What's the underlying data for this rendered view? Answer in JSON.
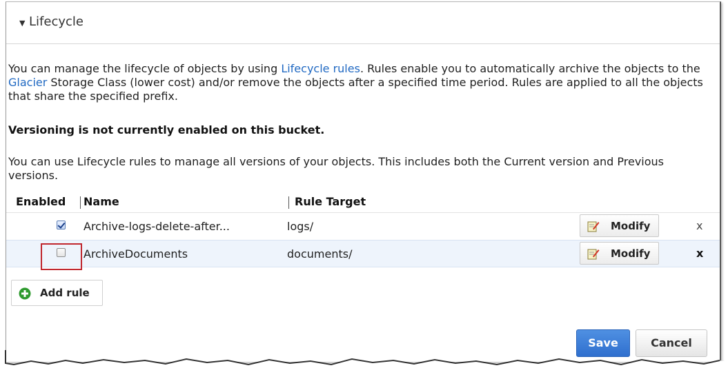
{
  "section": {
    "title": "Lifecycle",
    "caret_icon": "triangle-down-icon"
  },
  "intro": {
    "part1": "You can manage the lifecycle of objects by using ",
    "link_lifecycle": "Lifecycle rules",
    "part2": ". Rules enable you to automatically archive the objects to the ",
    "link_glacier": "Glacier",
    "part3": " Storage Class (lower cost) and/or remove the objects after a specified time period. Rules are applied to all the objects that share the specified prefix."
  },
  "warning": "Versioning is not currently enabled on this bucket.",
  "versions_text": "You can use Lifecycle rules to manage all versions of your objects. This includes both the Current version and Previous versions.",
  "table": {
    "headers": {
      "enabled": "Enabled",
      "name": "Name",
      "target": "Rule Target"
    },
    "rows": [
      {
        "enabled": true,
        "name": "Archive-logs-delete-after...",
        "target": "logs/",
        "modify_label": "Modify",
        "delete_label": "x"
      },
      {
        "enabled": false,
        "name": "ArchiveDocuments",
        "target": "documents/",
        "modify_label": "Modify",
        "delete_label": "x"
      }
    ]
  },
  "add_rule_label": "Add rule",
  "footer": {
    "save_label": "Save",
    "cancel_label": "Cancel"
  },
  "colors": {
    "link": "#1f68c2",
    "primary": "#2f6fce",
    "highlight": "#c0262d",
    "selected_row": "#eef4fc",
    "add_icon": "#2e9a2e"
  }
}
